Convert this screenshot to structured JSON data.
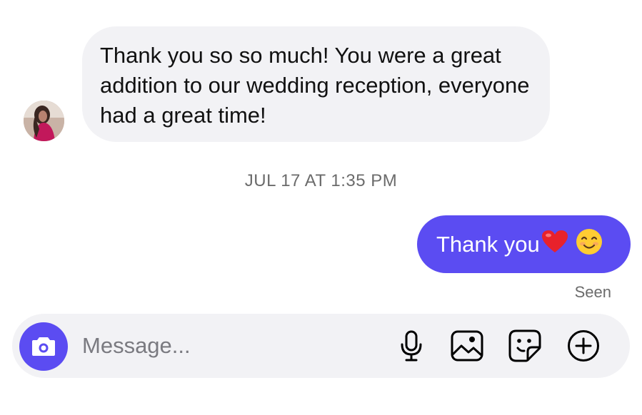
{
  "conversation": {
    "incoming": {
      "avatar_icon": "profile-photo",
      "text": "Thank you so so much! You were a great addition to our wedding reception, everyone had a great time!"
    },
    "timestamp": "JUL 17 AT 1:35 PM",
    "outgoing": {
      "text": "Thank you",
      "emoji_heart": "❤️",
      "emoji_smile": "😊"
    },
    "status": "Seen"
  },
  "composer": {
    "placeholder": "Message...",
    "icons": [
      "camera-icon",
      "microphone-icon",
      "gallery-icon",
      "sticker-icon",
      "plus-circle-icon"
    ]
  },
  "colors": {
    "accent": "#5b4cf2",
    "incoming_bubble": "#f2f2f5",
    "composer_bg": "#f2f2f5"
  }
}
